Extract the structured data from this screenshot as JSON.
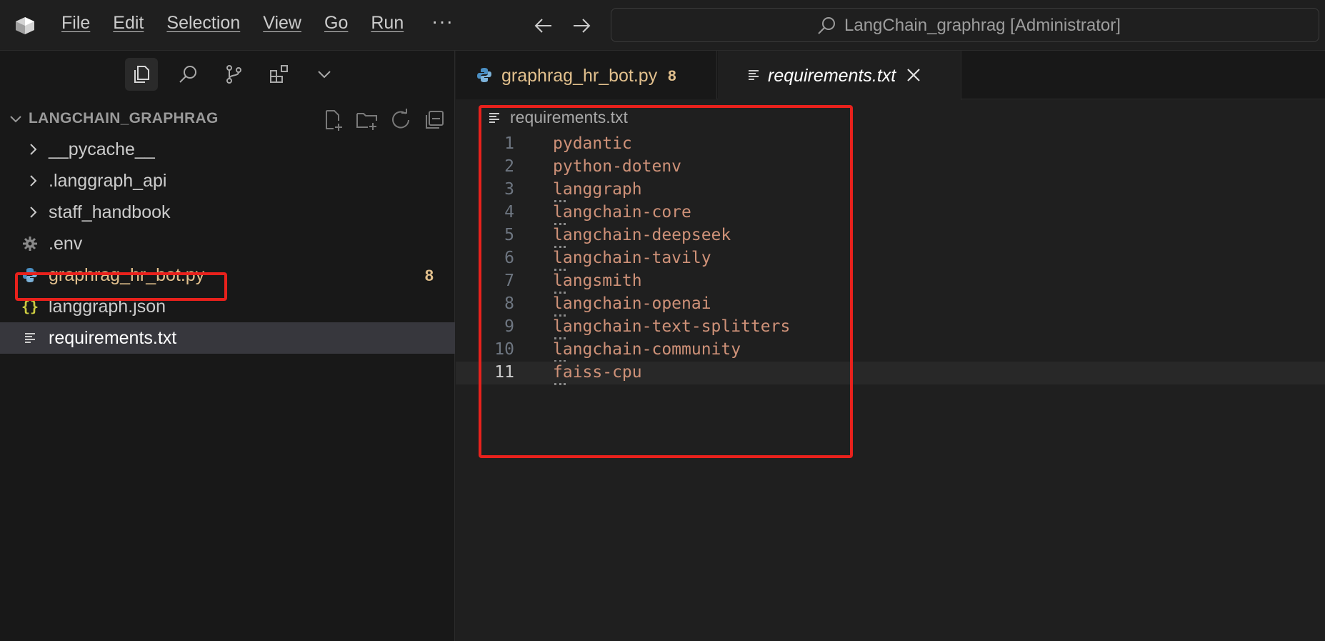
{
  "titlebar": {
    "menu": [
      "File",
      "Edit",
      "Selection",
      "View",
      "Go",
      "Run"
    ],
    "more": "···",
    "search_text": "LangChain_graphrag [Administrator]"
  },
  "sidebar": {
    "activity_icons": [
      "explorer-icon",
      "search-icon",
      "source-control-icon",
      "extensions-icon",
      "chevron-down-icon"
    ],
    "explorer_title": "LANGCHAIN_GRAPHRAG",
    "items": [
      {
        "label": "__pycache__",
        "type": "folder"
      },
      {
        "label": ".langgraph_api",
        "type": "folder"
      },
      {
        "label": "staff_handbook",
        "type": "folder"
      },
      {
        "label": ".env",
        "type": "env"
      },
      {
        "label": "graphrag_hr_bot.py",
        "type": "python",
        "badge": "8"
      },
      {
        "label": "langgraph.json",
        "type": "json"
      },
      {
        "label": "requirements.txt",
        "type": "text",
        "selected": true
      }
    ]
  },
  "editor": {
    "tabs": [
      {
        "label": "graphrag_hr_bot.py",
        "count": "8",
        "active": false
      },
      {
        "label": "requirements.txt",
        "active": true
      }
    ],
    "breadcrumb": "requirements.txt",
    "lines": [
      {
        "num": "1",
        "text": "pydantic",
        "squiggle": false
      },
      {
        "num": "2",
        "text": "python-dotenv",
        "squiggle": false
      },
      {
        "num": "3",
        "text": "langgraph",
        "squiggle": true
      },
      {
        "num": "4",
        "text": "langchain-core",
        "squiggle": true
      },
      {
        "num": "5",
        "text": "langchain-deepseek",
        "squiggle": true
      },
      {
        "num": "6",
        "text": "langchain-tavily",
        "squiggle": true
      },
      {
        "num": "7",
        "text": "langsmith",
        "squiggle": true
      },
      {
        "num": "8",
        "text": "langchain-openai",
        "squiggle": true
      },
      {
        "num": "9",
        "text": "langchain-text-splitters",
        "squiggle": true
      },
      {
        "num": "10",
        "text": "langchain-community",
        "squiggle": true
      },
      {
        "num": "11",
        "text": "faiss-cpu",
        "squiggle": true,
        "current": true
      }
    ]
  },
  "colors": {
    "highlight": "#e8211c",
    "string": "#ce9178",
    "modified": "#e2c08d"
  }
}
